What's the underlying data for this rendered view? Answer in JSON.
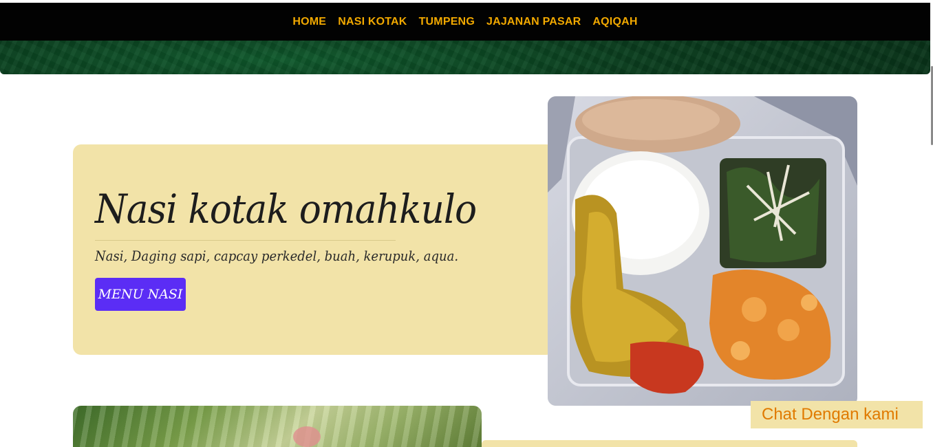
{
  "nav": {
    "items": [
      {
        "label": "HOME"
      },
      {
        "label": "NASI KOTAK"
      },
      {
        "label": "TUMPENG"
      },
      {
        "label": "JAJANAN PASAR"
      },
      {
        "label": "AQIQAH"
      }
    ]
  },
  "hero": {
    "title": "Nasi kotak omahkulo",
    "description": "Nasi, Daging sapi, capcay perkedel, buah, kerupuk, aqua.",
    "button_label": "MENU NASI"
  },
  "chat": {
    "label": "Chat Dengan kami"
  },
  "colors": {
    "nav_text": "#f2a900",
    "card_bg": "#f2e3a8",
    "button_bg": "#5b2df5",
    "chat_text": "#e07a00"
  }
}
